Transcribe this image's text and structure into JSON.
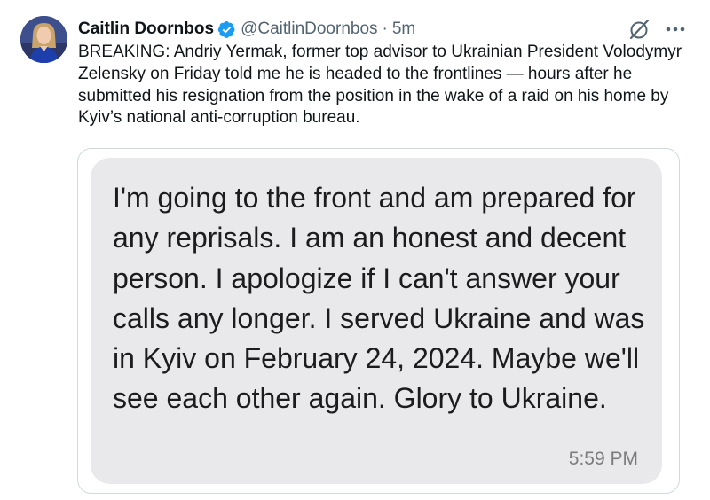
{
  "tweet": {
    "author": {
      "display_name": "Caitlin Doornbos",
      "handle": "@CaitlinDoornbos",
      "verified": true,
      "avatar_icon": "author-avatar"
    },
    "separator": "·",
    "timestamp": "5m",
    "header_icons": [
      "grok-icon",
      "more-options-icon"
    ],
    "text": "BREAKING: Andriy Yermak, former top advisor to Ukrainian President Volodymyr Zelensky on Friday told me he is headed to the frontlines — hours after he submitted his resignation from the position in the wake of a raid on his home by Kyiv’s national anti-corruption bureau.",
    "media": {
      "message_text": "I'm going to the front and am prepared for any reprisals. I am an honest and decent person. I apologize if I can't answer your calls any longer. I served Ukraine and was in Kyiv on February 24, 2024. Maybe we'll see each other again. Glory to Ukraine.",
      "message_time": "5:59 PM",
      "bubble_color": "#e9e9eb"
    },
    "colors": {
      "verified_badge": "#1d9bf0",
      "secondary_text": "#536471",
      "card_border": "#cfd9de"
    }
  }
}
